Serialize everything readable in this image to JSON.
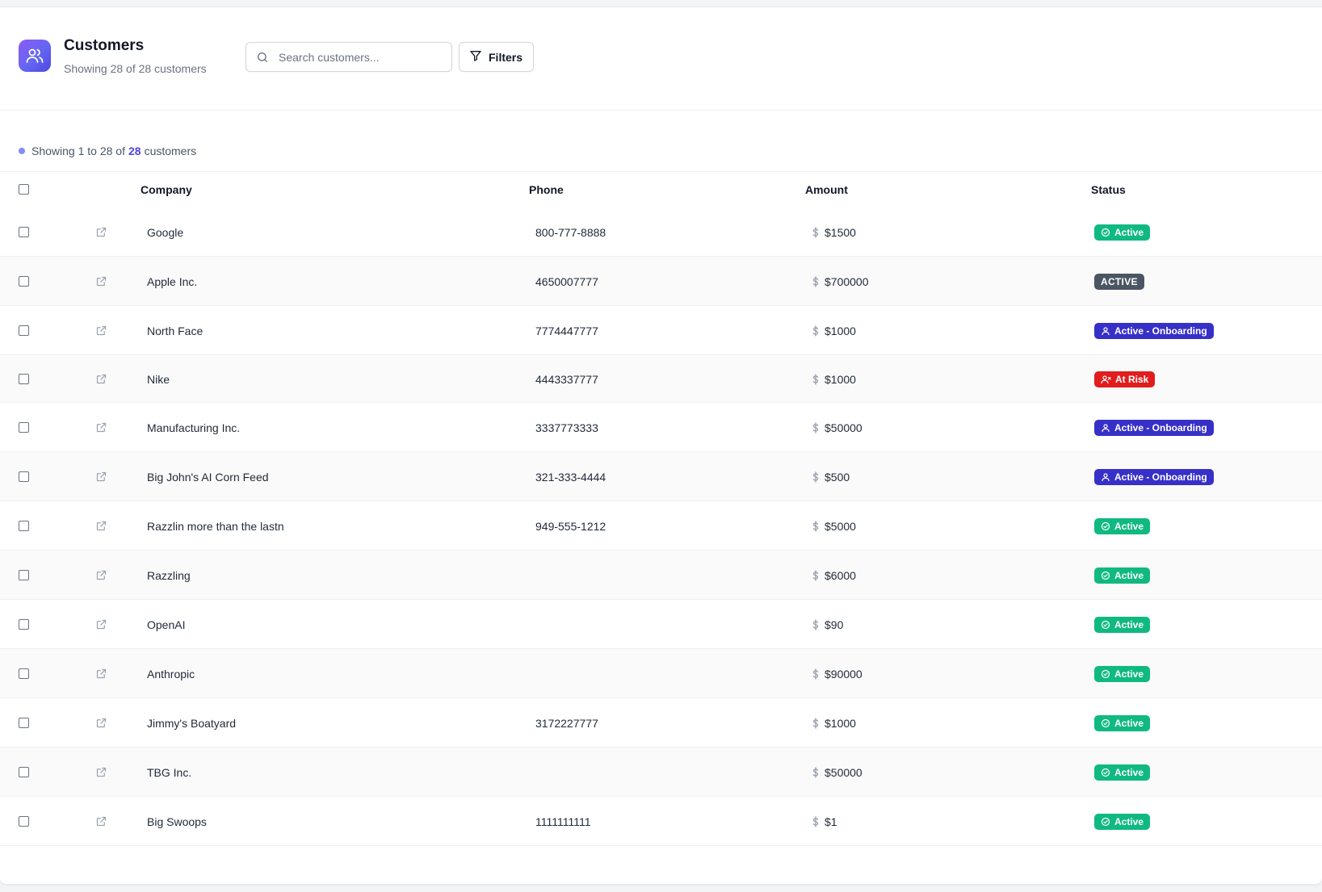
{
  "header": {
    "title": "Customers",
    "subtitle": "Showing 28 of 28 customers",
    "search_placeholder": "Search customers...",
    "filters_label": "Filters"
  },
  "summary": {
    "prefix": "Showing 1 to 28 of",
    "count": "28",
    "suffix": "customers"
  },
  "table": {
    "columns": [
      "Company",
      "Phone",
      "Amount",
      "Status"
    ],
    "rows": [
      {
        "company": "Google",
        "phone": "800-777-8888",
        "amount": "$1500",
        "status": "Active",
        "status_kind": "active"
      },
      {
        "company": "Apple Inc.",
        "phone": "4650007777",
        "amount": "$700000",
        "status": "ACTIVE",
        "status_kind": "active-caps"
      },
      {
        "company": "North Face",
        "phone": "7774447777",
        "amount": "$1000",
        "status": "Active - Onboarding",
        "status_kind": "onboarding"
      },
      {
        "company": "Nike",
        "phone": "4443337777",
        "amount": "$1000",
        "status": "At Risk",
        "status_kind": "risk"
      },
      {
        "company": "Manufacturing Inc.",
        "phone": "3337773333",
        "amount": "$50000",
        "status": "Active - Onboarding",
        "status_kind": "onboarding"
      },
      {
        "company": "Big John's AI Corn Feed",
        "phone": "321-333-4444",
        "amount": "$500",
        "status": "Active - Onboarding",
        "status_kind": "onboarding"
      },
      {
        "company": "Razzlin more than the lastn",
        "phone": "949-555-1212",
        "amount": "$5000",
        "status": "Active",
        "status_kind": "active"
      },
      {
        "company": "Razzling",
        "phone": "",
        "amount": "$6000",
        "status": "Active",
        "status_kind": "active"
      },
      {
        "company": "OpenAI",
        "phone": "",
        "amount": "$90",
        "status": "Active",
        "status_kind": "active"
      },
      {
        "company": "Anthropic",
        "phone": "",
        "amount": "$90000",
        "status": "Active",
        "status_kind": "active"
      },
      {
        "company": "Jimmy's Boatyard",
        "phone": "3172227777",
        "amount": "$1000",
        "status": "Active",
        "status_kind": "active"
      },
      {
        "company": "TBG Inc.",
        "phone": "",
        "amount": "$50000",
        "status": "Active",
        "status_kind": "active"
      },
      {
        "company": "Big Swoops",
        "phone": "1111111111",
        "amount": "$1",
        "status": "Active",
        "status_kind": "active"
      }
    ]
  },
  "colors": {
    "accent": "#6366f1",
    "active": "#10b981",
    "active_caps": "#4b5563",
    "onboarding": "#3730c8",
    "risk": "#e11d1d"
  },
  "icons": {
    "app": "users-icon",
    "search": "search-icon",
    "filter": "filter-icon",
    "row_link": "external-link-icon",
    "amount": "dollar-icon",
    "active": "check-circle-icon",
    "onboarding": "user-icon",
    "risk": "user-x-icon"
  }
}
